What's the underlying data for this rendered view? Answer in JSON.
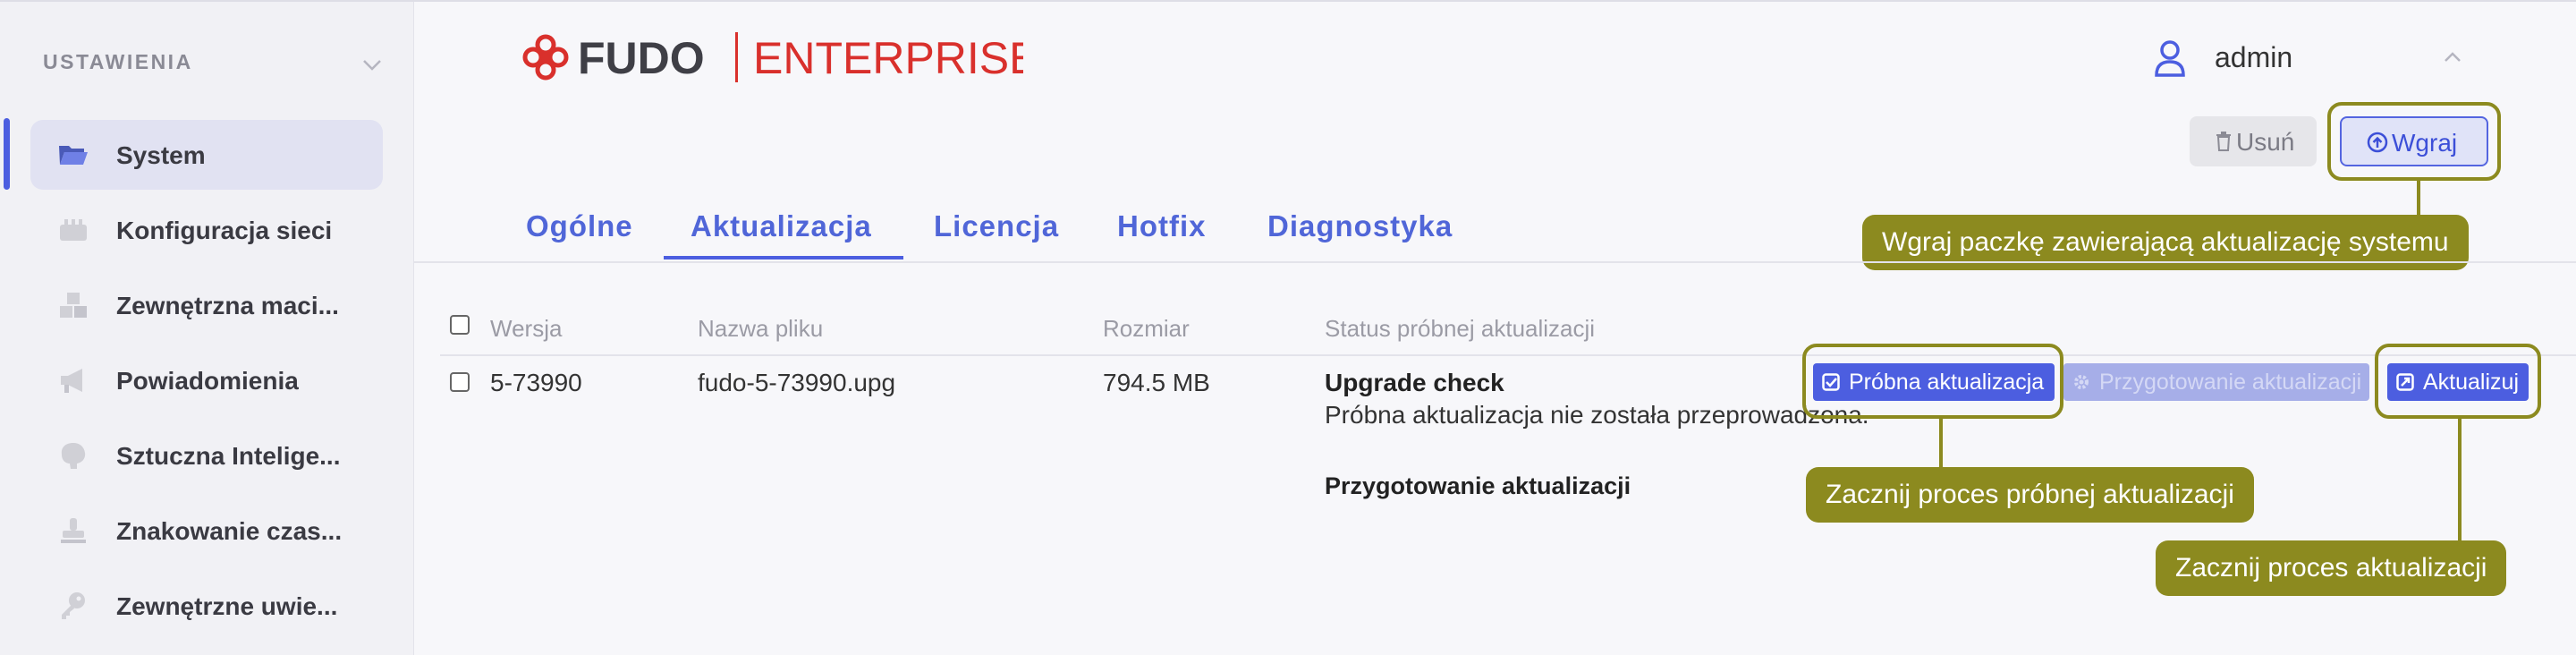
{
  "sidebar": {
    "header": "USTAWIENIA",
    "items": [
      {
        "label": "System",
        "icon": "folder-icon"
      },
      {
        "label": "Konfiguracja sieci",
        "icon": "network-icon"
      },
      {
        "label": "Zewnętrzna maci...",
        "icon": "cubes-icon"
      },
      {
        "label": "Powiadomienia",
        "icon": "megaphone-icon"
      },
      {
        "label": "Sztuczna Intelige...",
        "icon": "brain-icon"
      },
      {
        "label": "Znakowanie czas...",
        "icon": "stamp-icon"
      },
      {
        "label": "Zewnętrzne uwie...",
        "icon": "key-icon"
      }
    ]
  },
  "header": {
    "logo_brand": "FUDO",
    "logo_edition": "ENTERPRISE",
    "user": "admin"
  },
  "actions": {
    "delete_label": "Usuń",
    "upload_label": "Wgraj"
  },
  "tabs": [
    {
      "label": "Ogólne",
      "active": false
    },
    {
      "label": "Aktualizacja",
      "active": true
    },
    {
      "label": "Licencja",
      "active": false
    },
    {
      "label": "Hotfix",
      "active": false
    },
    {
      "label": "Diagnostyka",
      "active": false
    }
  ],
  "table": {
    "headers": [
      "Wersja",
      "Nazwa pliku",
      "Rozmiar",
      "Status próbnej aktualizacji"
    ],
    "rows": [
      {
        "version": "5-73990",
        "filename": "fudo-5-73990.upg",
        "size": "794.5 MB",
        "status_title": "Upgrade check",
        "status_text": "Próbna aktualizacja nie została przeprowadzona.",
        "status_title2": "Przygotowanie aktualizacji",
        "buttons": {
          "trial": "Próbna aktualizacja",
          "prepare": "Przygotowanie aktualizacji",
          "update": "Aktualizuj"
        }
      }
    ]
  },
  "tooltips": {
    "upload": "Wgraj paczkę zawierającą aktualizację systemu",
    "trial": "Zacznij proces próbnej aktualizacji",
    "update": "Zacznij proces aktualizacji"
  },
  "colors": {
    "accent": "#4c5ee0",
    "callout": "#8c8a1f",
    "logo_red": "#d9302c"
  }
}
